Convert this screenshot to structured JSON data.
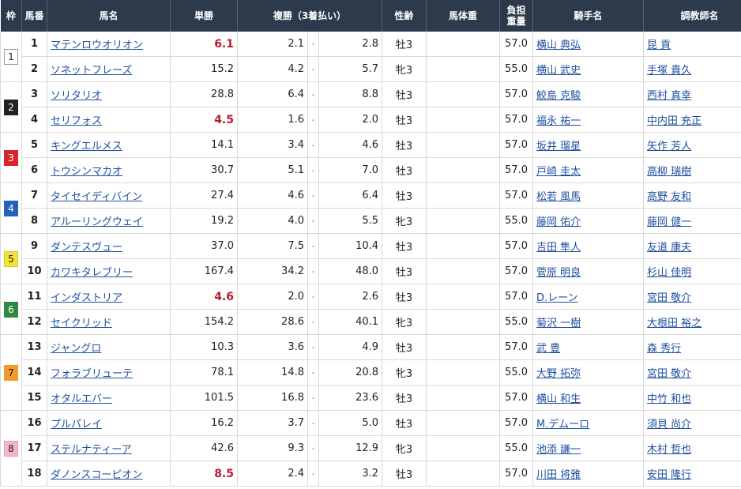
{
  "headers": {
    "waku": "枠",
    "umaban": "馬番",
    "name": "馬名",
    "win": "単勝",
    "place": "複勝（3着払い）",
    "sexage": "性齢",
    "weight": "馬体重",
    "burden_line1": "負担",
    "burden_line2": "重量",
    "jockey": "騎手名",
    "trainer": "調教師名"
  },
  "waku_colors": {
    "1": {
      "bg": "#ffffff",
      "fg": "#222222",
      "border": "#999999"
    },
    "2": {
      "bg": "#222222",
      "fg": "#ffffff",
      "border": "#222222"
    },
    "3": {
      "bg": "#d8262f",
      "fg": "#ffffff",
      "border": "#d8262f"
    },
    "4": {
      "bg": "#2463b8",
      "fg": "#ffffff",
      "border": "#2463b8"
    },
    "5": {
      "bg": "#f3e23a",
      "fg": "#222222",
      "border": "#d8c62a"
    },
    "6": {
      "bg": "#2e8a3e",
      "fg": "#ffffff",
      "border": "#2e8a3e"
    },
    "7": {
      "bg": "#f39a2a",
      "fg": "#222222",
      "border": "#f39a2a"
    },
    "8": {
      "bg": "#f4b6c8",
      "fg": "#222222",
      "border": "#e79ab0"
    }
  },
  "waku_groups": [
    {
      "waku": "1",
      "rows": 2
    },
    {
      "waku": "2",
      "rows": 2
    },
    {
      "waku": "3",
      "rows": 2
    },
    {
      "waku": "4",
      "rows": 2
    },
    {
      "waku": "5",
      "rows": 2
    },
    {
      "waku": "6",
      "rows": 2
    },
    {
      "waku": "7",
      "rows": 3
    },
    {
      "waku": "8",
      "rows": 3
    }
  ],
  "rows": [
    {
      "num": "1",
      "name": "マテンロウオリオン",
      "win": "6.1",
      "fav": true,
      "pl_min": "2.1",
      "pl_max": "2.8",
      "sexage": "牡3",
      "weight": "",
      "burden": "57.0",
      "jockey": "横山 典弘",
      "trainer": "昆 貢"
    },
    {
      "num": "2",
      "name": "ソネットフレーズ",
      "win": "15.2",
      "fav": false,
      "pl_min": "4.2",
      "pl_max": "5.7",
      "sexage": "牝3",
      "weight": "",
      "burden": "55.0",
      "jockey": "横山 武史",
      "trainer": "手塚 貴久"
    },
    {
      "num": "3",
      "name": "ソリタリオ",
      "win": "28.8",
      "fav": false,
      "pl_min": "6.4",
      "pl_max": "8.8",
      "sexage": "牡3",
      "weight": "",
      "burden": "57.0",
      "jockey": "鮫島 克駿",
      "trainer": "西村 真幸"
    },
    {
      "num": "4",
      "name": "セリフォス",
      "win": "4.5",
      "fav": true,
      "pl_min": "1.6",
      "pl_max": "2.0",
      "sexage": "牡3",
      "weight": "",
      "burden": "57.0",
      "jockey": "福永 祐一",
      "trainer": "中内田 充正"
    },
    {
      "num": "5",
      "name": "キングエルメス",
      "win": "14.1",
      "fav": false,
      "pl_min": "3.4",
      "pl_max": "4.6",
      "sexage": "牡3",
      "weight": "",
      "burden": "57.0",
      "jockey": "坂井 瑠星",
      "trainer": "矢作 芳人"
    },
    {
      "num": "6",
      "name": "トウシンマカオ",
      "win": "30.7",
      "fav": false,
      "pl_min": "5.1",
      "pl_max": "7.0",
      "sexage": "牡3",
      "weight": "",
      "burden": "57.0",
      "jockey": "戸崎 圭太",
      "trainer": "高柳 瑞樹"
    },
    {
      "num": "7",
      "name": "タイセイディバイン",
      "win": "27.4",
      "fav": false,
      "pl_min": "4.6",
      "pl_max": "6.4",
      "sexage": "牡3",
      "weight": "",
      "burden": "57.0",
      "jockey": "松若 風馬",
      "trainer": "高野 友和"
    },
    {
      "num": "8",
      "name": "アルーリングウェイ",
      "win": "19.2",
      "fav": false,
      "pl_min": "4.0",
      "pl_max": "5.5",
      "sexage": "牝3",
      "weight": "",
      "burden": "55.0",
      "jockey": "藤岡 佑介",
      "trainer": "藤岡 健一"
    },
    {
      "num": "9",
      "name": "ダンテスヴュー",
      "win": "37.0",
      "fav": false,
      "pl_min": "7.5",
      "pl_max": "10.4",
      "sexage": "牡3",
      "weight": "",
      "burden": "57.0",
      "jockey": "吉田 隼人",
      "trainer": "友道 康夫"
    },
    {
      "num": "10",
      "name": "カワキタレブリー",
      "win": "167.4",
      "fav": false,
      "pl_min": "34.2",
      "pl_max": "48.0",
      "sexage": "牡3",
      "weight": "",
      "burden": "57.0",
      "jockey": "菅原 明良",
      "trainer": "杉山 佳明"
    },
    {
      "num": "11",
      "name": "インダストリア",
      "win": "4.6",
      "fav": true,
      "pl_min": "2.0",
      "pl_max": "2.6",
      "sexage": "牡3",
      "weight": "",
      "burden": "57.0",
      "jockey": "D.レーン",
      "trainer": "宮田 敬介"
    },
    {
      "num": "12",
      "name": "セイクリッド",
      "win": "154.2",
      "fav": false,
      "pl_min": "28.6",
      "pl_max": "40.1",
      "sexage": "牝3",
      "weight": "",
      "burden": "55.0",
      "jockey": "菊沢 一樹",
      "trainer": "大根田 裕之"
    },
    {
      "num": "13",
      "name": "ジャングロ",
      "win": "10.3",
      "fav": false,
      "pl_min": "3.6",
      "pl_max": "4.9",
      "sexage": "牡3",
      "weight": "",
      "burden": "57.0",
      "jockey": "武 豊",
      "trainer": "森 秀行"
    },
    {
      "num": "14",
      "name": "フォラブリューテ",
      "win": "78.1",
      "fav": false,
      "pl_min": "14.8",
      "pl_max": "20.8",
      "sexage": "牝3",
      "weight": "",
      "burden": "55.0",
      "jockey": "大野 拓弥",
      "trainer": "宮田 敬介"
    },
    {
      "num": "15",
      "name": "オタルエバー",
      "win": "101.5",
      "fav": false,
      "pl_min": "16.8",
      "pl_max": "23.6",
      "sexage": "牡3",
      "weight": "",
      "burden": "57.0",
      "jockey": "横山 和生",
      "trainer": "中竹 和也"
    },
    {
      "num": "16",
      "name": "プルパレイ",
      "win": "16.2",
      "fav": false,
      "pl_min": "3.7",
      "pl_max": "5.0",
      "sexage": "牡3",
      "weight": "",
      "burden": "57.0",
      "jockey": "M.デムーロ",
      "trainer": "須貝 尚介"
    },
    {
      "num": "17",
      "name": "ステルナティーア",
      "win": "42.6",
      "fav": false,
      "pl_min": "9.3",
      "pl_max": "12.9",
      "sexage": "牝3",
      "weight": "",
      "burden": "55.0",
      "jockey": "池添 謙一",
      "trainer": "木村 哲也"
    },
    {
      "num": "18",
      "name": "ダノンスコーピオン",
      "win": "8.5",
      "fav": true,
      "pl_min": "2.4",
      "pl_max": "3.2",
      "sexage": "牡3",
      "weight": "",
      "burden": "57.0",
      "jockey": "川田 将雅",
      "trainer": "安田 隆行"
    }
  ],
  "dash": "-"
}
